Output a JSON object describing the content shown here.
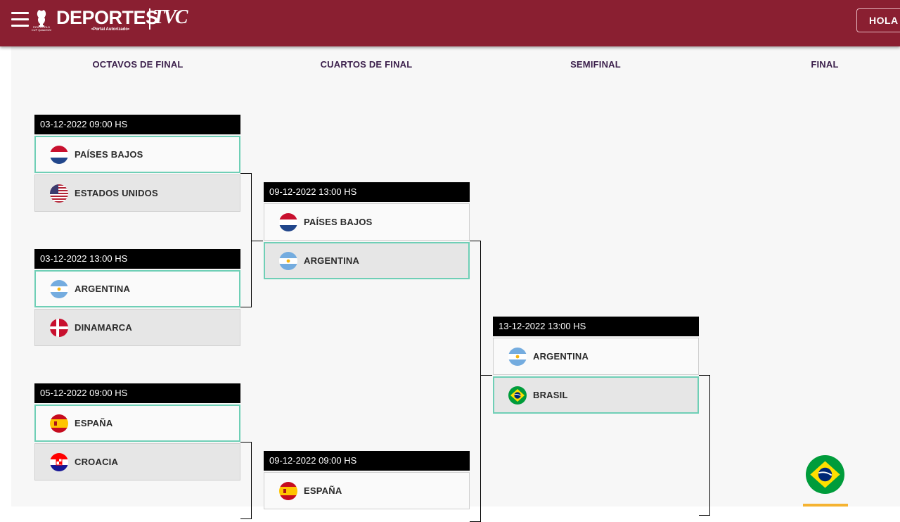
{
  "header": {
    "menu_icon": "hamburger-menu-icon",
    "logo_trophy_text": "FIFA WORLD CUP Qatar2022",
    "logo_title": "DEPORTES",
    "logo_brand": "TVC",
    "logo_subtitle": "•Portal Autorizado•",
    "user_button": "HOLA",
    "colors": {
      "bar": "#8a1f31"
    }
  },
  "rounds": [
    {
      "title": "OCTAVOS DE FINAL"
    },
    {
      "title": "CUARTOS DE FINAL"
    },
    {
      "title": "SEMIFINAL"
    },
    {
      "title": "FINAL"
    }
  ],
  "matches": {
    "r16_1": {
      "date": "03-12-2022 09:00 HS",
      "team1": "PAÍSES BAJOS",
      "team2": "ESTADOS UNIDOS",
      "winner": "team1"
    },
    "r16_2": {
      "date": "03-12-2022 13:00 HS",
      "team1": "ARGENTINA",
      "team2": "DINAMARCA",
      "winner": "team1"
    },
    "r16_3": {
      "date": "05-12-2022 09:00 HS",
      "team1": "ESPAÑA",
      "team2": "CROACIA",
      "winner": "team1"
    },
    "qf_1": {
      "date": "09-12-2022 13:00 HS",
      "team1": "PAÍSES BAJOS",
      "team2": "ARGENTINA",
      "winner": "team2"
    },
    "qf_2": {
      "date": "09-12-2022 09:00 HS",
      "team1": "ESPAÑA"
    },
    "sf_1": {
      "date": "13-12-2022 13:00 HS",
      "team1": "ARGENTINA",
      "team2": "BRASIL",
      "winner": "team2"
    }
  },
  "flags": {
    "netherlands": "netherlands-flag-icon",
    "usa": "usa-flag-icon",
    "argentina": "argentina-flag-icon",
    "denmark": "denmark-flag-icon",
    "spain": "spain-flag-icon",
    "croatia": "croatia-flag-icon",
    "brazil": "brazil-flag-icon"
  },
  "colors": {
    "winner_border": "#6fcfb6",
    "date_bar": "#000000",
    "round_title": "#3b1f4b"
  }
}
